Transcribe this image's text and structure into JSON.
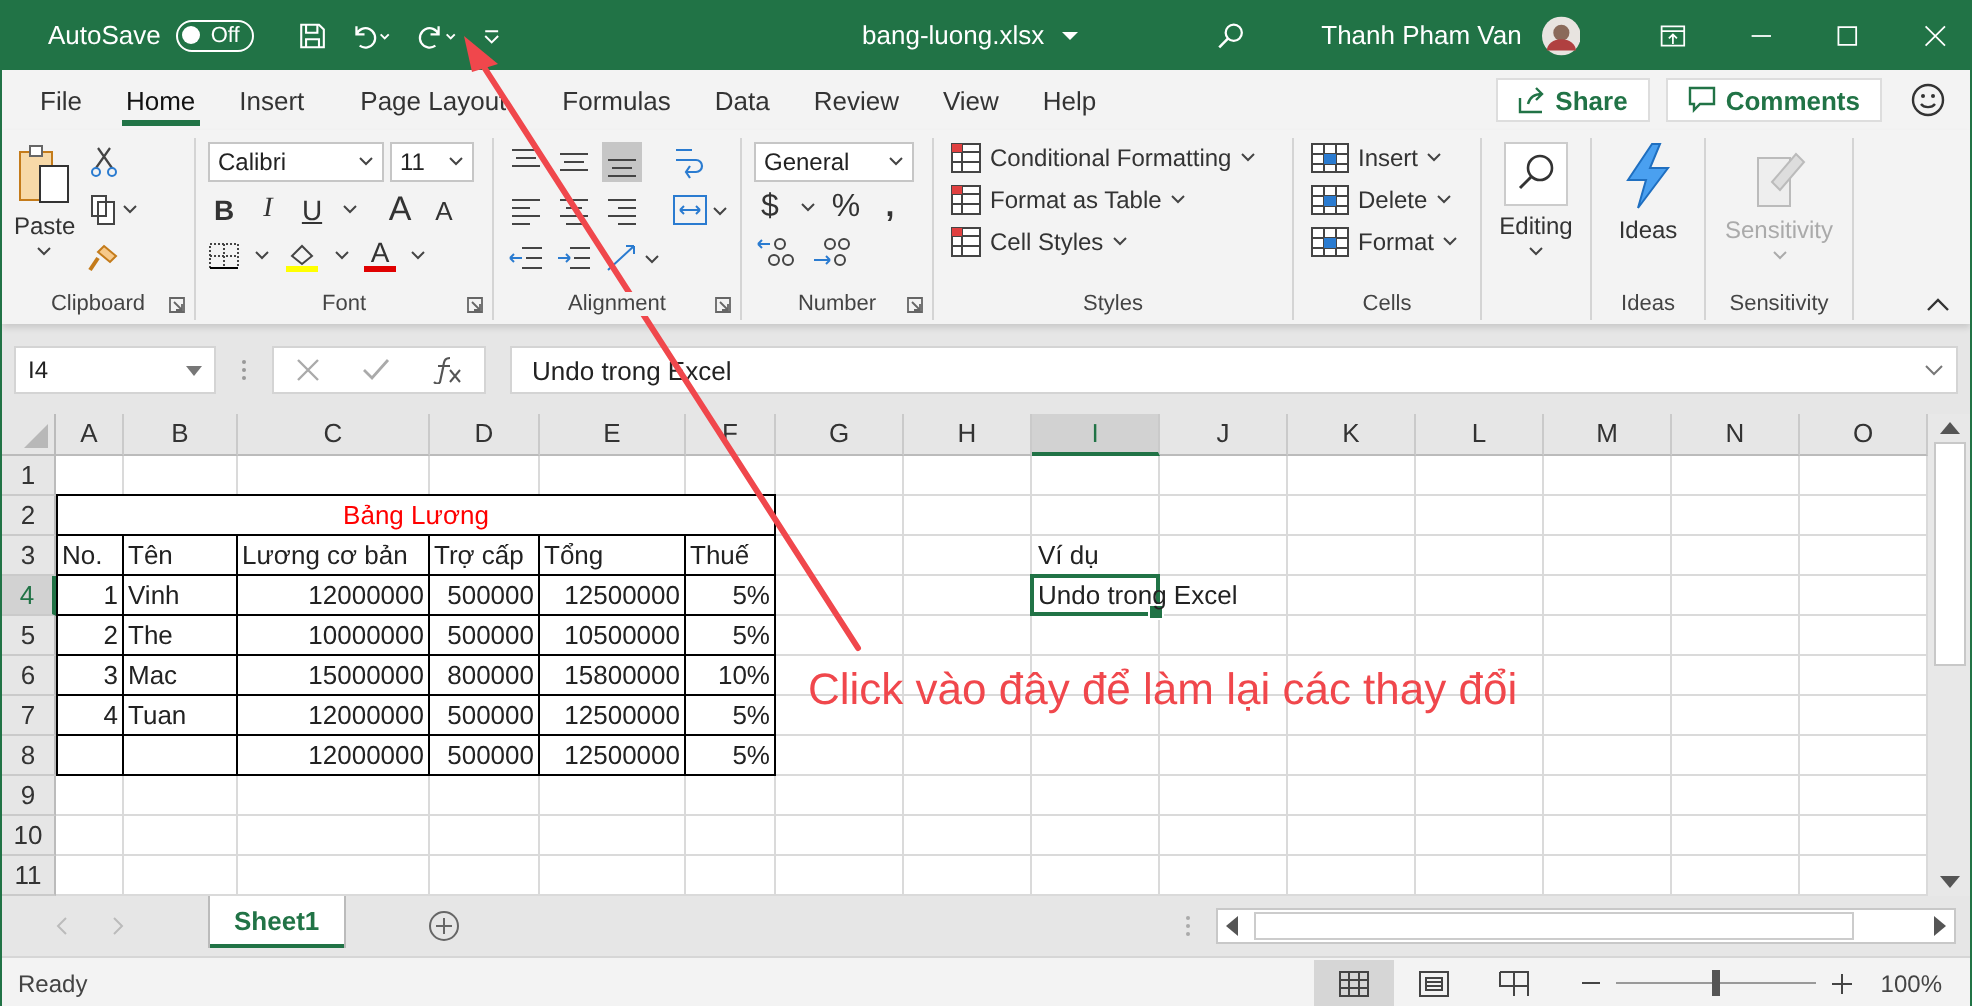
{
  "title_bar": {
    "autosave": "AutoSave",
    "autosave_toggle": {
      "label": "Off",
      "on": false
    },
    "filename": "bang-luong.xlsx",
    "user": "Thanh Pham Van"
  },
  "tabs": [
    {
      "label": "File",
      "selected": false
    },
    {
      "label": "Home",
      "selected": true
    },
    {
      "label": "Insert",
      "selected": false
    },
    {
      "label": "Page Layout",
      "selected": false
    },
    {
      "label": "Formulas",
      "selected": false
    },
    {
      "label": "Data",
      "selected": false
    },
    {
      "label": "Review",
      "selected": false
    },
    {
      "label": "View",
      "selected": false
    },
    {
      "label": "Help",
      "selected": false
    }
  ],
  "share": "Share",
  "comments": "Comments",
  "ribbon": {
    "clipboard": {
      "label": "Clipboard",
      "paste": "Paste"
    },
    "font": {
      "label": "Font",
      "family": "Calibri",
      "size": "11",
      "bold": "B",
      "italic": "I",
      "underline": "U",
      "grow": "A",
      "shrink": "A",
      "color_letter": "A"
    },
    "alignment": {
      "label": "Alignment"
    },
    "number": {
      "label": "Number",
      "format": "General",
      "currency": "$",
      "percent": "%",
      "comma": ","
    },
    "styles": {
      "label": "Styles",
      "items": [
        "Conditional Formatting",
        "Format as Table",
        "Cell Styles"
      ]
    },
    "cells": {
      "label": "Cells",
      "items": [
        "Insert",
        "Delete",
        "Format"
      ]
    },
    "editing": {
      "label": "Editing"
    },
    "ideas": {
      "label": "Ideas",
      "button": "Ideas"
    },
    "sensitivity": {
      "label": "Sensitivity",
      "button": "Sensitivity",
      "disabled": true
    }
  },
  "formula_bar": {
    "name_box": "I4",
    "formula": "Undo trong Excel"
  },
  "sheet": {
    "columns": [
      {
        "label": "A",
        "selected": false
      },
      {
        "label": "B",
        "selected": false
      },
      {
        "label": "C",
        "selected": false
      },
      {
        "label": "D",
        "selected": false
      },
      {
        "label": "E",
        "selected": false
      },
      {
        "label": "F",
        "selected": false
      },
      {
        "label": "G",
        "selected": false
      },
      {
        "label": "H",
        "selected": false
      },
      {
        "label": "I",
        "selected": true
      },
      {
        "label": "J",
        "selected": false
      },
      {
        "label": "K",
        "selected": false
      },
      {
        "label": "L",
        "selected": false
      },
      {
        "label": "M",
        "selected": false
      },
      {
        "label": "N",
        "selected": false
      },
      {
        "label": "O",
        "selected": false
      }
    ],
    "rows": [
      {
        "label": "1",
        "selected": false
      },
      {
        "label": "2",
        "selected": false
      },
      {
        "label": "3",
        "selected": false
      },
      {
        "label": "4",
        "selected": true
      },
      {
        "label": "5",
        "selected": false
      },
      {
        "label": "6",
        "selected": false
      },
      {
        "label": "7",
        "selected": false
      },
      {
        "label": "8",
        "selected": false
      },
      {
        "label": "9",
        "selected": false
      },
      {
        "label": "10",
        "selected": false
      },
      {
        "label": "11",
        "selected": false
      }
    ],
    "salary_table": {
      "title": "Bảng Lương",
      "headers": [
        "No.",
        "Tên",
        "Lương cơ bản",
        "Trợ cấp",
        "Tổng",
        "Thuế"
      ],
      "rows": [
        [
          "1",
          "Vinh",
          "12000000",
          "500000",
          "12500000",
          "5%"
        ],
        [
          "2",
          "The",
          "10000000",
          "500000",
          "10500000",
          "5%"
        ],
        [
          "3",
          "Mac",
          "15000000",
          "800000",
          "15800000",
          "10%"
        ],
        [
          "4",
          "Tuan",
          "12000000",
          "500000",
          "12500000",
          "5%"
        ],
        [
          null,
          null,
          "12000000",
          "500000",
          "12500000",
          "5%"
        ]
      ]
    },
    "example": {
      "label": "Ví dụ",
      "value": "Undo trong Excel",
      "selected": true
    }
  },
  "sheet_tabs": [
    {
      "label": "Sheet1",
      "selected": true
    }
  ],
  "status_bar": {
    "status": "Ready",
    "views": [
      {
        "kind": "normal",
        "selected": true
      },
      {
        "kind": "page-layout",
        "selected": false
      },
      {
        "kind": "page-break",
        "selected": false
      }
    ],
    "zoom": {
      "level": 0.5,
      "reading": "100%"
    }
  },
  "annotation": {
    "text": "Click vào đây để làm lại các thay đổi"
  }
}
